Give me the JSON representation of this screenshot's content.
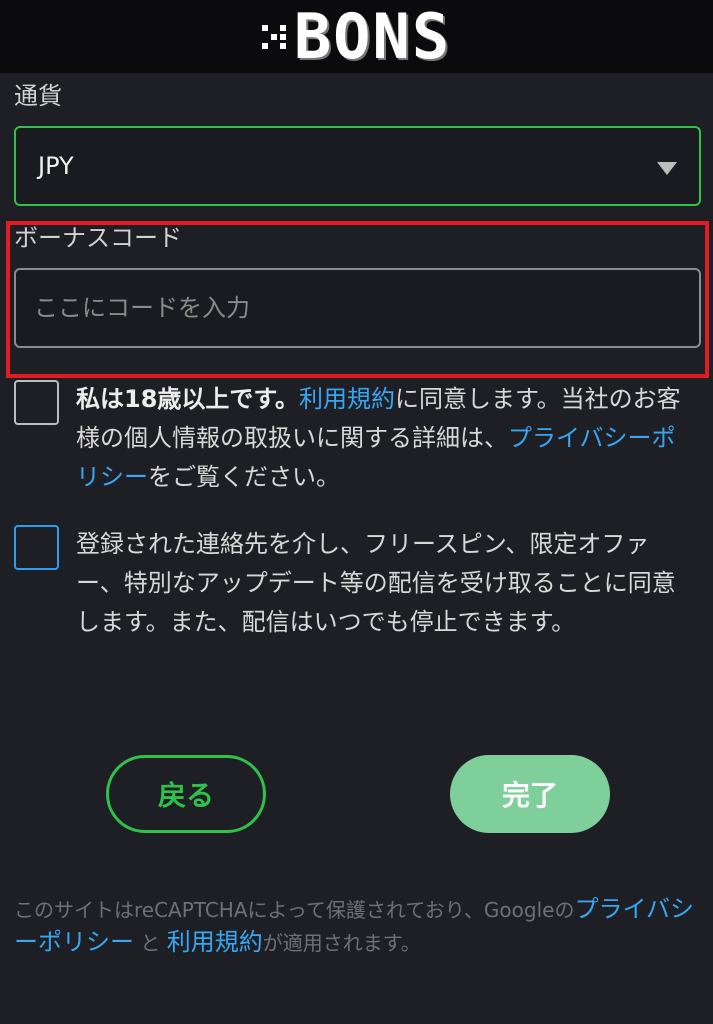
{
  "header": {
    "logo_text": "BONS"
  },
  "currency": {
    "label": "通貨",
    "selected": "JPY"
  },
  "bonus": {
    "label": "ボーナスコード",
    "placeholder": "ここにコードを入力"
  },
  "terms": {
    "bold": "私は18歳以上です。",
    "link_terms": "利用規約",
    "mid1": "に同意します。当社のお客様の個人情報の取扱いに関する詳細は、",
    "link_privacy": "プライバシーポリシー",
    "end": "をご覧ください。"
  },
  "marketing": {
    "text": "登録された連絡先を介し、フリースピン、限定オファー、特別なアップデート等の配信を受け取ることに同意します。また、配信はいつでも停止できます。"
  },
  "buttons": {
    "back": "戻る",
    "done": "完了"
  },
  "footer": {
    "pre": "このサイトはreCAPTCHAによって保護されており、Googleの",
    "link_privacy": "プライバシーポリシー",
    "and": "と",
    "link_terms": "利用規約",
    "post": "が適用されます。"
  },
  "colors": {
    "accent_green": "#2fc24a",
    "link_blue": "#37a6f3",
    "highlight_red": "#e51b24",
    "done_button": "#7fcf9a"
  }
}
